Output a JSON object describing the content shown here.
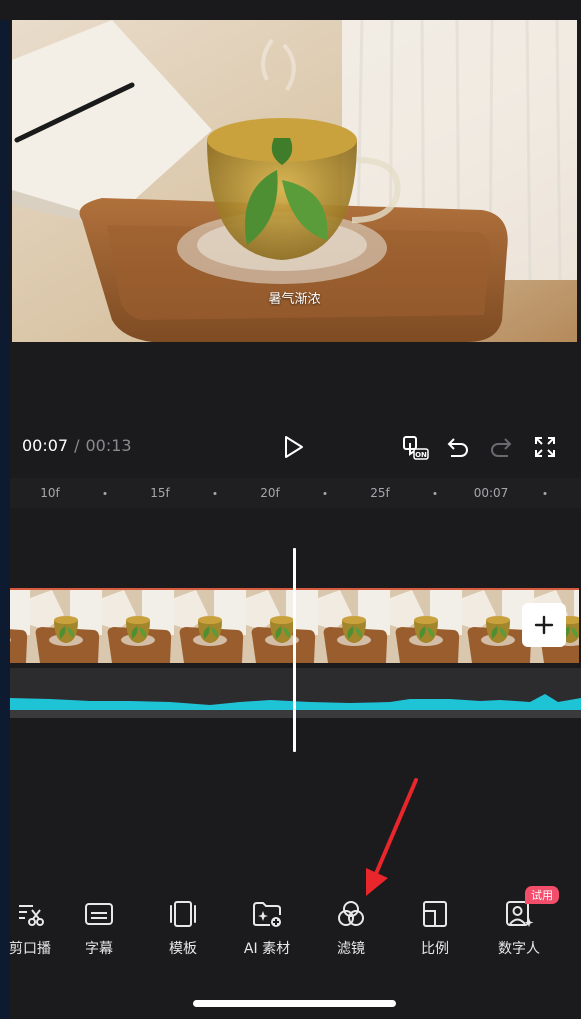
{
  "preview": {
    "caption": "暑气渐浓"
  },
  "playback": {
    "current_time": "00:07",
    "separator": "/",
    "total_time": "00:13"
  },
  "ruler": {
    "ticks": [
      "10f",
      "15f",
      "20f",
      "25f",
      "00:07"
    ]
  },
  "toolbar": {
    "items": [
      {
        "label": "剪口播",
        "icon": "scissors-text-icon"
      },
      {
        "label": "字幕",
        "icon": "subtitle-icon"
      },
      {
        "label": "模板",
        "icon": "template-icon"
      },
      {
        "label": "AI 素材",
        "icon": "ai-folder-icon"
      },
      {
        "label": "滤镜",
        "icon": "filter-icon"
      },
      {
        "label": "比例",
        "icon": "aspect-ratio-icon"
      },
      {
        "label": "数字人",
        "icon": "digital-human-icon"
      }
    ],
    "badge": "试用"
  },
  "colors": {
    "background": "#1b1b1d",
    "audio_wave": "#1fc3d6",
    "track_border": "#d75b3f",
    "badge": "#f24d6a",
    "annotation_arrow": "#e8262c"
  }
}
